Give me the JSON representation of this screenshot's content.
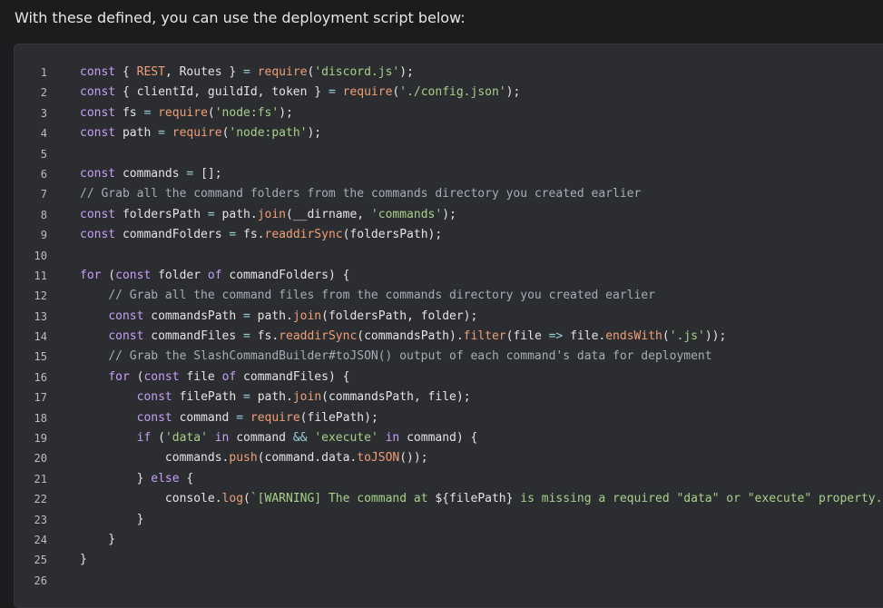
{
  "intro_text": "With these defined, you can use the deployment script below:",
  "colors": {
    "background": "#1c1c1e",
    "code_background": "#2b2d31",
    "keyword": "#c6a0f6",
    "string": "#a6d189",
    "function": "#ef9f76",
    "comment": "#a5adb8",
    "text": "#e4e4e4"
  },
  "code_lines": [
    {
      "n": "1",
      "segs": [
        [
          "kw",
          "const"
        ],
        [
          "var",
          " { "
        ],
        [
          "fn",
          "REST"
        ],
        [
          "var",
          ", Routes } "
        ],
        [
          "op",
          "="
        ],
        [
          "var",
          " "
        ],
        [
          "fn",
          "require"
        ],
        [
          "var",
          "("
        ],
        [
          "str",
          "'discord.js'"
        ],
        [
          "var",
          ");"
        ]
      ]
    },
    {
      "n": "2",
      "segs": [
        [
          "kw",
          "const"
        ],
        [
          "var",
          " { clientId, guildId, token } "
        ],
        [
          "op",
          "="
        ],
        [
          "var",
          " "
        ],
        [
          "fn",
          "require"
        ],
        [
          "var",
          "("
        ],
        [
          "str",
          "'./config.json'"
        ],
        [
          "var",
          ");"
        ]
      ]
    },
    {
      "n": "3",
      "segs": [
        [
          "kw",
          "const"
        ],
        [
          "var",
          " fs "
        ],
        [
          "op",
          "="
        ],
        [
          "var",
          " "
        ],
        [
          "fn",
          "require"
        ],
        [
          "var",
          "("
        ],
        [
          "str",
          "'node:fs'"
        ],
        [
          "var",
          ");"
        ]
      ]
    },
    {
      "n": "4",
      "segs": [
        [
          "kw",
          "const"
        ],
        [
          "var",
          " path "
        ],
        [
          "op",
          "="
        ],
        [
          "var",
          " "
        ],
        [
          "fn",
          "require"
        ],
        [
          "var",
          "("
        ],
        [
          "str",
          "'node:path'"
        ],
        [
          "var",
          ");"
        ]
      ]
    },
    {
      "n": "5",
      "segs": []
    },
    {
      "n": "6",
      "segs": [
        [
          "kw",
          "const"
        ],
        [
          "var",
          " commands "
        ],
        [
          "op",
          "="
        ],
        [
          "var",
          " [];"
        ]
      ]
    },
    {
      "n": "7",
      "segs": [
        [
          "cm",
          "// Grab all the command folders from the commands directory you created earlier"
        ]
      ]
    },
    {
      "n": "8",
      "segs": [
        [
          "kw",
          "const"
        ],
        [
          "var",
          " foldersPath "
        ],
        [
          "op",
          "="
        ],
        [
          "var",
          " path."
        ],
        [
          "fn",
          "join"
        ],
        [
          "var",
          "(__dirname, "
        ],
        [
          "str",
          "'commands'"
        ],
        [
          "var",
          ");"
        ]
      ]
    },
    {
      "n": "9",
      "segs": [
        [
          "kw",
          "const"
        ],
        [
          "var",
          " commandFolders "
        ],
        [
          "op",
          "="
        ],
        [
          "var",
          " fs."
        ],
        [
          "fn",
          "readdirSync"
        ],
        [
          "var",
          "(foldersPath);"
        ]
      ]
    },
    {
      "n": "10",
      "segs": []
    },
    {
      "n": "11",
      "segs": [
        [
          "kw",
          "for"
        ],
        [
          "var",
          " ("
        ],
        [
          "kw",
          "const"
        ],
        [
          "var",
          " folder "
        ],
        [
          "kw",
          "of"
        ],
        [
          "var",
          " commandFolders) {"
        ]
      ]
    },
    {
      "n": "12",
      "segs": [
        [
          "var",
          "    "
        ],
        [
          "cm",
          "// Grab all the command files from the commands directory you created earlier"
        ]
      ]
    },
    {
      "n": "13",
      "segs": [
        [
          "var",
          "    "
        ],
        [
          "kw",
          "const"
        ],
        [
          "var",
          " commandsPath "
        ],
        [
          "op",
          "="
        ],
        [
          "var",
          " path."
        ],
        [
          "fn",
          "join"
        ],
        [
          "var",
          "(foldersPath, folder);"
        ]
      ]
    },
    {
      "n": "14",
      "segs": [
        [
          "var",
          "    "
        ],
        [
          "kw",
          "const"
        ],
        [
          "var",
          " commandFiles "
        ],
        [
          "op",
          "="
        ],
        [
          "var",
          " fs."
        ],
        [
          "fn",
          "readdirSync"
        ],
        [
          "var",
          "(commandsPath)."
        ],
        [
          "fn",
          "filter"
        ],
        [
          "var",
          "(file "
        ],
        [
          "op",
          "=>"
        ],
        [
          "var",
          " file."
        ],
        [
          "fn",
          "endsWith"
        ],
        [
          "var",
          "("
        ],
        [
          "str",
          "'.js'"
        ],
        [
          "var",
          "));"
        ]
      ]
    },
    {
      "n": "15",
      "segs": [
        [
          "var",
          "    "
        ],
        [
          "cm",
          "// Grab the SlashCommandBuilder#toJSON() output of each command's data for deployment"
        ]
      ]
    },
    {
      "n": "16",
      "segs": [
        [
          "var",
          "    "
        ],
        [
          "kw",
          "for"
        ],
        [
          "var",
          " ("
        ],
        [
          "kw",
          "const"
        ],
        [
          "var",
          " file "
        ],
        [
          "kw",
          "of"
        ],
        [
          "var",
          " commandFiles) {"
        ]
      ]
    },
    {
      "n": "17",
      "segs": [
        [
          "var",
          "        "
        ],
        [
          "kw",
          "const"
        ],
        [
          "var",
          " filePath "
        ],
        [
          "op",
          "="
        ],
        [
          "var",
          " path."
        ],
        [
          "fn",
          "join"
        ],
        [
          "var",
          "(commandsPath, file);"
        ]
      ]
    },
    {
      "n": "18",
      "segs": [
        [
          "var",
          "        "
        ],
        [
          "kw",
          "const"
        ],
        [
          "var",
          " command "
        ],
        [
          "op",
          "="
        ],
        [
          "var",
          " "
        ],
        [
          "fn",
          "require"
        ],
        [
          "var",
          "(filePath);"
        ]
      ]
    },
    {
      "n": "19",
      "segs": [
        [
          "var",
          "        "
        ],
        [
          "kw",
          "if"
        ],
        [
          "var",
          " ("
        ],
        [
          "str",
          "'data'"
        ],
        [
          "var",
          " "
        ],
        [
          "kw",
          "in"
        ],
        [
          "var",
          " command "
        ],
        [
          "op",
          "&&"
        ],
        [
          "var",
          " "
        ],
        [
          "str",
          "'execute'"
        ],
        [
          "var",
          " "
        ],
        [
          "kw",
          "in"
        ],
        [
          "var",
          " command) {"
        ]
      ]
    },
    {
      "n": "20",
      "segs": [
        [
          "var",
          "            commands."
        ],
        [
          "fn",
          "push"
        ],
        [
          "var",
          "(command.data."
        ],
        [
          "fn",
          "toJSON"
        ],
        [
          "var",
          "());"
        ]
      ]
    },
    {
      "n": "21",
      "segs": [
        [
          "var",
          "        } "
        ],
        [
          "kw",
          "else"
        ],
        [
          "var",
          " {"
        ]
      ]
    },
    {
      "n": "22",
      "segs": [
        [
          "var",
          "            console."
        ],
        [
          "fn",
          "log"
        ],
        [
          "var",
          "("
        ],
        [
          "str",
          "`[WARNING] The command at "
        ],
        [
          "var",
          "${filePath}"
        ],
        [
          "str",
          " is missing a required \"data\" or \"execute\" property.`"
        ],
        [
          "var",
          ");"
        ]
      ]
    },
    {
      "n": "23",
      "segs": [
        [
          "var",
          "        }"
        ]
      ]
    },
    {
      "n": "24",
      "segs": [
        [
          "var",
          "    }"
        ]
      ]
    },
    {
      "n": "25",
      "segs": [
        [
          "var",
          "}"
        ]
      ]
    },
    {
      "n": "26",
      "segs": []
    }
  ]
}
